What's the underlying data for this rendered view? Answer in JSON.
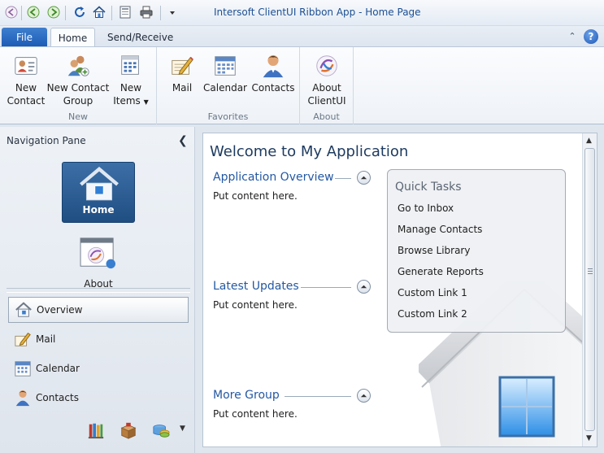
{
  "window": {
    "title": "Intersoft ClientUI Ribbon App - Home Page"
  },
  "quick_access": {
    "icons": [
      "back-icon",
      "green-back-icon",
      "green-forward-icon",
      "refresh-icon",
      "home-icon",
      "save-icon",
      "print-icon",
      "dropdown-icon"
    ]
  },
  "tabs": {
    "file": "File",
    "home": "Home",
    "send_receive": "Send/Receive"
  },
  "ribbon": {
    "groups": [
      {
        "label": "New",
        "buttons": [
          {
            "label": "New\nContact",
            "line1": "New",
            "line2": "Contact",
            "icon": "contact-card-icon"
          },
          {
            "label": "New Contact Group",
            "line1": "New Contact",
            "line2": "Group",
            "icon": "contact-group-icon"
          },
          {
            "label": "New Items",
            "line1": "New",
            "line2": "Items",
            "icon": "new-items-icon",
            "has_dropdown": true
          }
        ]
      },
      {
        "label": "Favorites",
        "buttons": [
          {
            "label": "Mail",
            "icon": "mail-icon"
          },
          {
            "label": "Calendar",
            "icon": "calendar-icon"
          },
          {
            "label": "Contacts",
            "icon": "contacts-icon"
          }
        ]
      },
      {
        "label": "About",
        "buttons": [
          {
            "label": "About ClientUI",
            "line1": "About",
            "line2": "ClientUI",
            "icon": "clientui-logo-icon"
          }
        ]
      }
    ]
  },
  "nav": {
    "title": "Navigation Pane",
    "tiles": [
      {
        "label": "Home",
        "icon": "house-icon",
        "selected": true
      },
      {
        "label": "About",
        "icon": "about-window-icon"
      }
    ],
    "items": [
      {
        "label": "Overview",
        "icon": "house-icon",
        "selected": true
      },
      {
        "label": "Mail",
        "icon": "mail-icon"
      },
      {
        "label": "Calendar",
        "icon": "calendar-icon"
      },
      {
        "label": "Contacts",
        "icon": "contacts-icon"
      }
    ],
    "mini_icons": [
      "library-icon",
      "box-icon",
      "database-icon"
    ]
  },
  "content": {
    "title": "Welcome to My Application",
    "sections": [
      {
        "title": "Application Overview",
        "body": "Put content here."
      },
      {
        "title": "Latest Updates",
        "body": "Put content here."
      },
      {
        "title": "More Group",
        "body": "Put content here."
      }
    ],
    "quick_tasks": {
      "title": "Quick Tasks",
      "links": [
        "Go to Inbox",
        "Manage Contacts",
        "Browse Library",
        "Generate Reports",
        "Custom Link 1",
        "Custom Link 2"
      ]
    }
  },
  "colors": {
    "file_tab": "#1c5bb5",
    "title_text": "#1d4f91",
    "section_title": "#2458a3",
    "home_tile": "#2a5a92"
  }
}
